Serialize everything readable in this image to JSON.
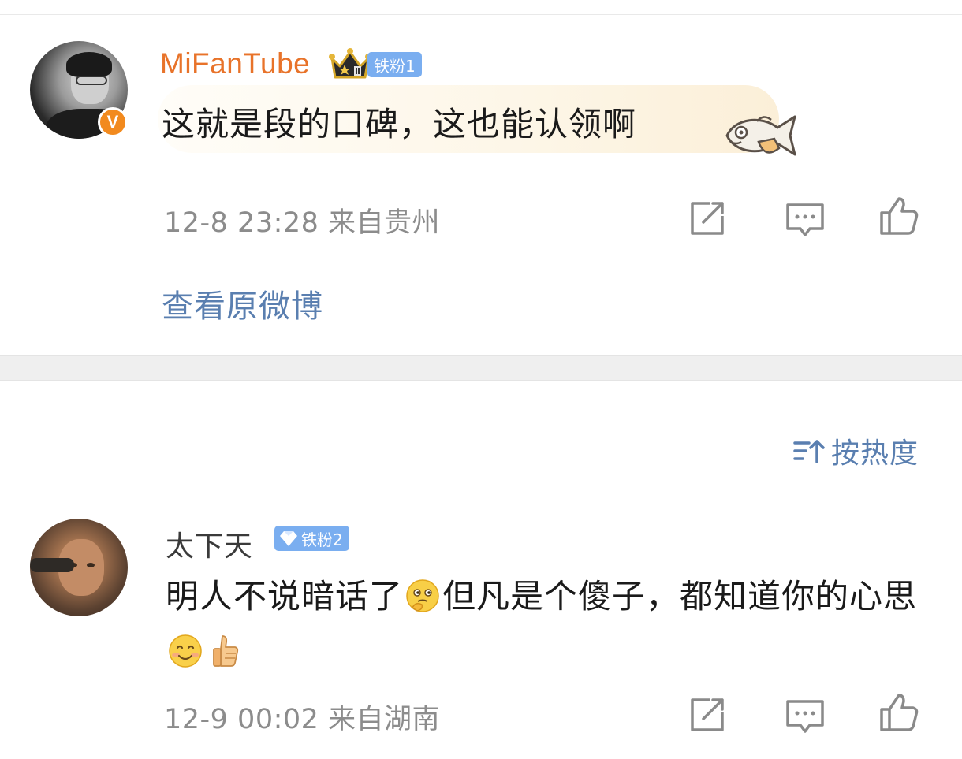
{
  "post1": {
    "username": "MiFanTube",
    "fan_badge": "铁粉1",
    "content": "这就是段的口碑，这也能认领啊",
    "meta": "12-8 23:28  来自贵州",
    "view_original": "查看原微博",
    "verified_mark": "V",
    "username_color": "#e8732a"
  },
  "sort": {
    "label": "按热度",
    "icon": "sort-icon"
  },
  "post2": {
    "username": "太下天",
    "fan_badge": "铁粉2",
    "content_part1": "明人不说暗话了",
    "content_part2": "但凡是个傻子，都知道你的心思",
    "meta": "12-9 00:02  来自湖南"
  },
  "icons": {
    "share": "share-icon",
    "comment": "comment-icon",
    "like": "thumbs-up-icon"
  },
  "colors": {
    "link": "#5a7fb0",
    "badge": "#7aaef0",
    "meta": "#8c8c8c"
  }
}
